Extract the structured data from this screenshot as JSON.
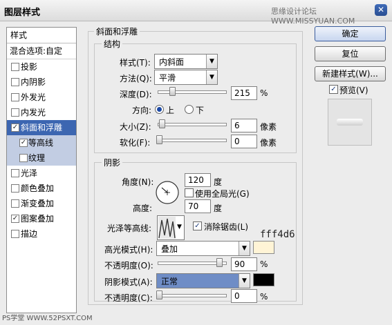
{
  "title": "图层样式",
  "watermark": "思缘设计论坛  WWW.MISSYUAN.COM",
  "bottom_watermark": "PS学堂 WWW.52PSXT.COM",
  "annotation": "fff4d6",
  "left_panel": {
    "header": "样式",
    "blend_options": "混合选项:自定",
    "items": [
      {
        "label": "投影",
        "checked": "",
        "state": "normal"
      },
      {
        "label": "内阴影",
        "checked": "",
        "state": "normal"
      },
      {
        "label": "外发光",
        "checked": "",
        "state": "normal"
      },
      {
        "label": "内发光",
        "checked": "",
        "state": "normal"
      },
      {
        "label": "斜面和浮雕",
        "checked": "☑",
        "state": "selected"
      },
      {
        "label": "等高线",
        "checked": "☑",
        "state": "sub"
      },
      {
        "label": "纹理",
        "checked": "",
        "state": "sub"
      },
      {
        "label": "光泽",
        "checked": "",
        "state": "normal"
      },
      {
        "label": "颜色叠加",
        "checked": "",
        "state": "normal"
      },
      {
        "label": "渐变叠加",
        "checked": "",
        "state": "normal"
      },
      {
        "label": "图案叠加",
        "checked": "☑",
        "state": "normal"
      },
      {
        "label": "描边",
        "checked": "",
        "state": "normal"
      }
    ]
  },
  "bevel": {
    "title": "斜面和浮雕",
    "structure": {
      "title": "结构",
      "style_label": "样式(T):",
      "style_value": "内斜面",
      "technique_label": "方法(Q):",
      "technique_value": "平滑",
      "depth_label": "深度(D):",
      "depth_value": "215",
      "depth_unit": "%",
      "depth_percent": 0.215,
      "direction_label": "方向:",
      "direction_up": "上",
      "direction_down": "下",
      "size_label": "大小(Z):",
      "size_value": "6",
      "size_unit": "像素",
      "soften_label": "软化(F):",
      "soften_value": "0",
      "soften_unit": "像素"
    },
    "shading": {
      "title": "阴影",
      "angle_label": "角度(N):",
      "angle_value": "120",
      "angle_unit": "度",
      "global_light_label": "使用全局光(G)",
      "altitude_label": "高度:",
      "altitude_value": "70",
      "altitude_unit": "度",
      "gloss_contour_label": "光泽等高线:",
      "antialias_label": "消除锯齿(L)",
      "highlight_mode_label": "高光模式(H):",
      "highlight_mode_value": "叠加",
      "highlight_color": "#fff4d6",
      "highlight_opacity_label": "不透明度(O):",
      "highlight_opacity_value": "90",
      "highlight_opacity_unit": "%",
      "shadow_mode_label": "阴影模式(A):",
      "shadow_mode_value": "正常",
      "shadow_color": "#000000",
      "shadow_opacity_label": "不透明度(C):",
      "shadow_opacity_value": "0",
      "shadow_opacity_unit": "%"
    }
  },
  "buttons": {
    "ok": "确定",
    "reset": "复位",
    "new_style": "新建样式(W)...",
    "preview": "预览(V)"
  },
  "icons": {
    "close": "✕",
    "dropdown": "▼",
    "check": "✓"
  }
}
